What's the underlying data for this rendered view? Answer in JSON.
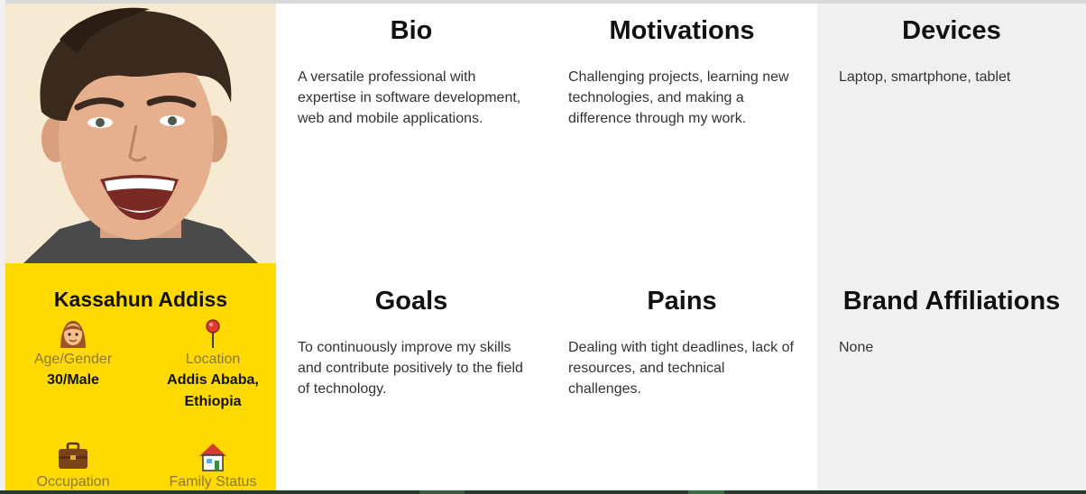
{
  "profile": {
    "name": "Kassahun Addiss",
    "attributes": [
      {
        "icon": "person-icon",
        "label": "Age/Gender",
        "value": "30/Male"
      },
      {
        "icon": "map-pin-icon",
        "label": "Location",
        "value": "Addis Ababa, Ethiopia"
      },
      {
        "icon": "briefcase-icon",
        "label": "Occupation",
        "value": ""
      },
      {
        "icon": "house-icon",
        "label": "Family Status",
        "value": ""
      }
    ]
  },
  "sections": {
    "bio": {
      "title": "Bio",
      "text": "A versatile professional with expertise in software development, web and mobile applications."
    },
    "motivations": {
      "title": "Motivations",
      "text": "Challenging projects, learning new technologies, and making a difference through my work."
    },
    "devices": {
      "title": "Devices",
      "text": "Laptop, smartphone, tablet"
    },
    "goals": {
      "title": "Goals",
      "text": "To continuously improve my skills and contribute positively to the field of technology."
    },
    "pains": {
      "title": "Pains",
      "text": "Dealing with tight deadlines, lack of resources, and technical challenges."
    },
    "brand": {
      "title": "Brand Affiliations",
      "text": "None"
    }
  },
  "colors": {
    "accent": "#ffd900",
    "panel": "#f0f0f0"
  }
}
